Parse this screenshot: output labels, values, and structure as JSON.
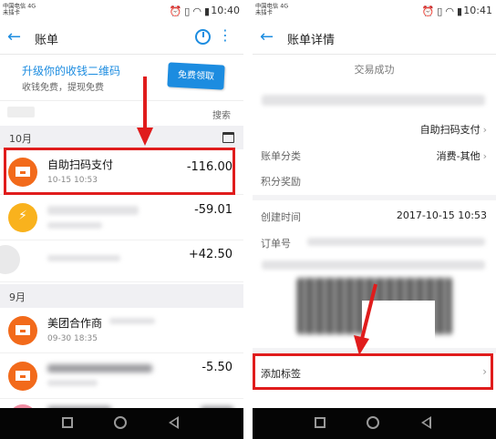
{
  "status_bar": {
    "carrier_line1": "中国电信 4G",
    "carrier_line2": "未插卡",
    "left_time": "10:40",
    "right_time": "10:41",
    "icons": [
      "alarm-icon",
      "vibrate-icon",
      "wifi-icon",
      "battery-icon"
    ]
  },
  "left_screen": {
    "title": "账单",
    "banner": {
      "headline": "升级你的收钱二维码",
      "subline": "收钱免费，提现免费",
      "button": "免费领取"
    },
    "search_label": "搜索",
    "month_current": "10月",
    "month_prev": "9月",
    "transactions_october": [
      {
        "name": "自助扫码支付",
        "date": "10-15  10:53",
        "amount": "-116.00",
        "icon": "shop-icon",
        "color": "#f26a1b"
      },
      {
        "name": "",
        "date": "",
        "amount": "-59.01",
        "icon": "lightning-icon",
        "color": "#f9b21d"
      },
      {
        "name": "",
        "date": "",
        "amount": "+42.50",
        "icon": "avatar-icon",
        "color": "#e9e9ea"
      }
    ],
    "transactions_september": [
      {
        "name": "美团合作商",
        "date": "09-30  18:35",
        "amount": "",
        "icon": "shop-icon",
        "color": "#f26a1b"
      },
      {
        "name": "",
        "date": "",
        "amount": "-5.50",
        "icon": "shop-icon",
        "color": "#f26a1b"
      },
      {
        "name": "",
        "date": "",
        "amount": "",
        "icon": "gift-icon",
        "color": "#f08ca2"
      }
    ]
  },
  "right_screen": {
    "title": "账单详情",
    "trade_status": "交易成功",
    "merchant_link": "自助扫码支付",
    "category_label": "账单分类",
    "category_value": "消费-其他",
    "points_label": "积分奖励",
    "created_label": "创建时间",
    "created_value": "2017-10-15 10:53",
    "order_label": "订单号",
    "add_tag_label": "添加标签"
  },
  "colors": {
    "accent": "#1c8ce0",
    "highlight": "#e01c1c",
    "navbar": "#050505"
  }
}
